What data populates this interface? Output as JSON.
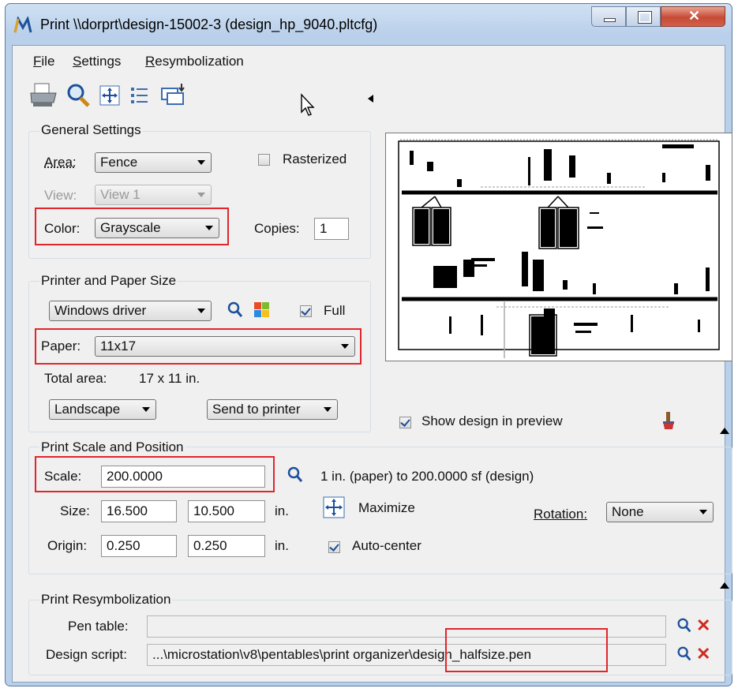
{
  "window": {
    "title": "Print  \\\\dorprt\\design-15002-3  (design_hp_9040.pltcfg)"
  },
  "menu": [
    {
      "label": "File",
      "underline": "F",
      "rest": "ile"
    },
    {
      "label": "Settings",
      "underline": "S",
      "rest": "ettings"
    },
    {
      "label": "Resymbolization",
      "underline": "R",
      "rest": "esymbolization"
    }
  ],
  "toolbar": {
    "icons": [
      "printer-icon",
      "preview-magnifier-icon",
      "fit-crosshair-icon",
      "list-icon",
      "page-setup-icon"
    ]
  },
  "general": {
    "title": "General Settings",
    "area_label": "Area:",
    "area_value": "Fence",
    "rasterized_label": "Rasterized",
    "rasterized_checked": false,
    "view_label": "View:",
    "view_value": "View 1",
    "color_label": "Color:",
    "color_value": "Grayscale",
    "copies_label": "Copies:",
    "copies_value": "1"
  },
  "printer": {
    "title": "Printer and Paper Size",
    "driver_value": "Windows driver",
    "full_label": "Full",
    "full_checked": true,
    "paper_label": "Paper:",
    "paper_value": "11x17",
    "total_area_label": "Total area:",
    "total_area_value": "17 x 11 in.",
    "orientation_value": "Landscape",
    "send_value": "Send to printer"
  },
  "preview": {
    "show_design_label": "Show design in preview",
    "show_design_checked": true
  },
  "scale": {
    "title": "Print Scale and Position",
    "scale_label": "Scale:",
    "scale_value": "200.0000",
    "scale_desc": "1 in. (paper) to 200.0000 sf (design)",
    "size_label": "Size:",
    "size_w": "16.500",
    "size_h": "10.500",
    "size_unit": "in.",
    "maximize_label": "Maximize",
    "rotation_label": "Rotation:",
    "rotation_value": "None",
    "origin_label": "Origin:",
    "origin_x": "0.250",
    "origin_y": "0.250",
    "origin_unit": "in.",
    "autocenter_label": "Auto-center",
    "autocenter_checked": true
  },
  "resym": {
    "title": "Print Resymbolization",
    "pen_table_label": "Pen table:",
    "pen_table_value": "",
    "design_script_label": "Design script:",
    "design_script_value": "...\\microstation\\v8\\pentables\\print organizer\\design_halfsize.pen"
  },
  "colors": {
    "highlight": "#e0252b",
    "close_button": "#c74a35",
    "titlebar": "#b9d0ea"
  }
}
